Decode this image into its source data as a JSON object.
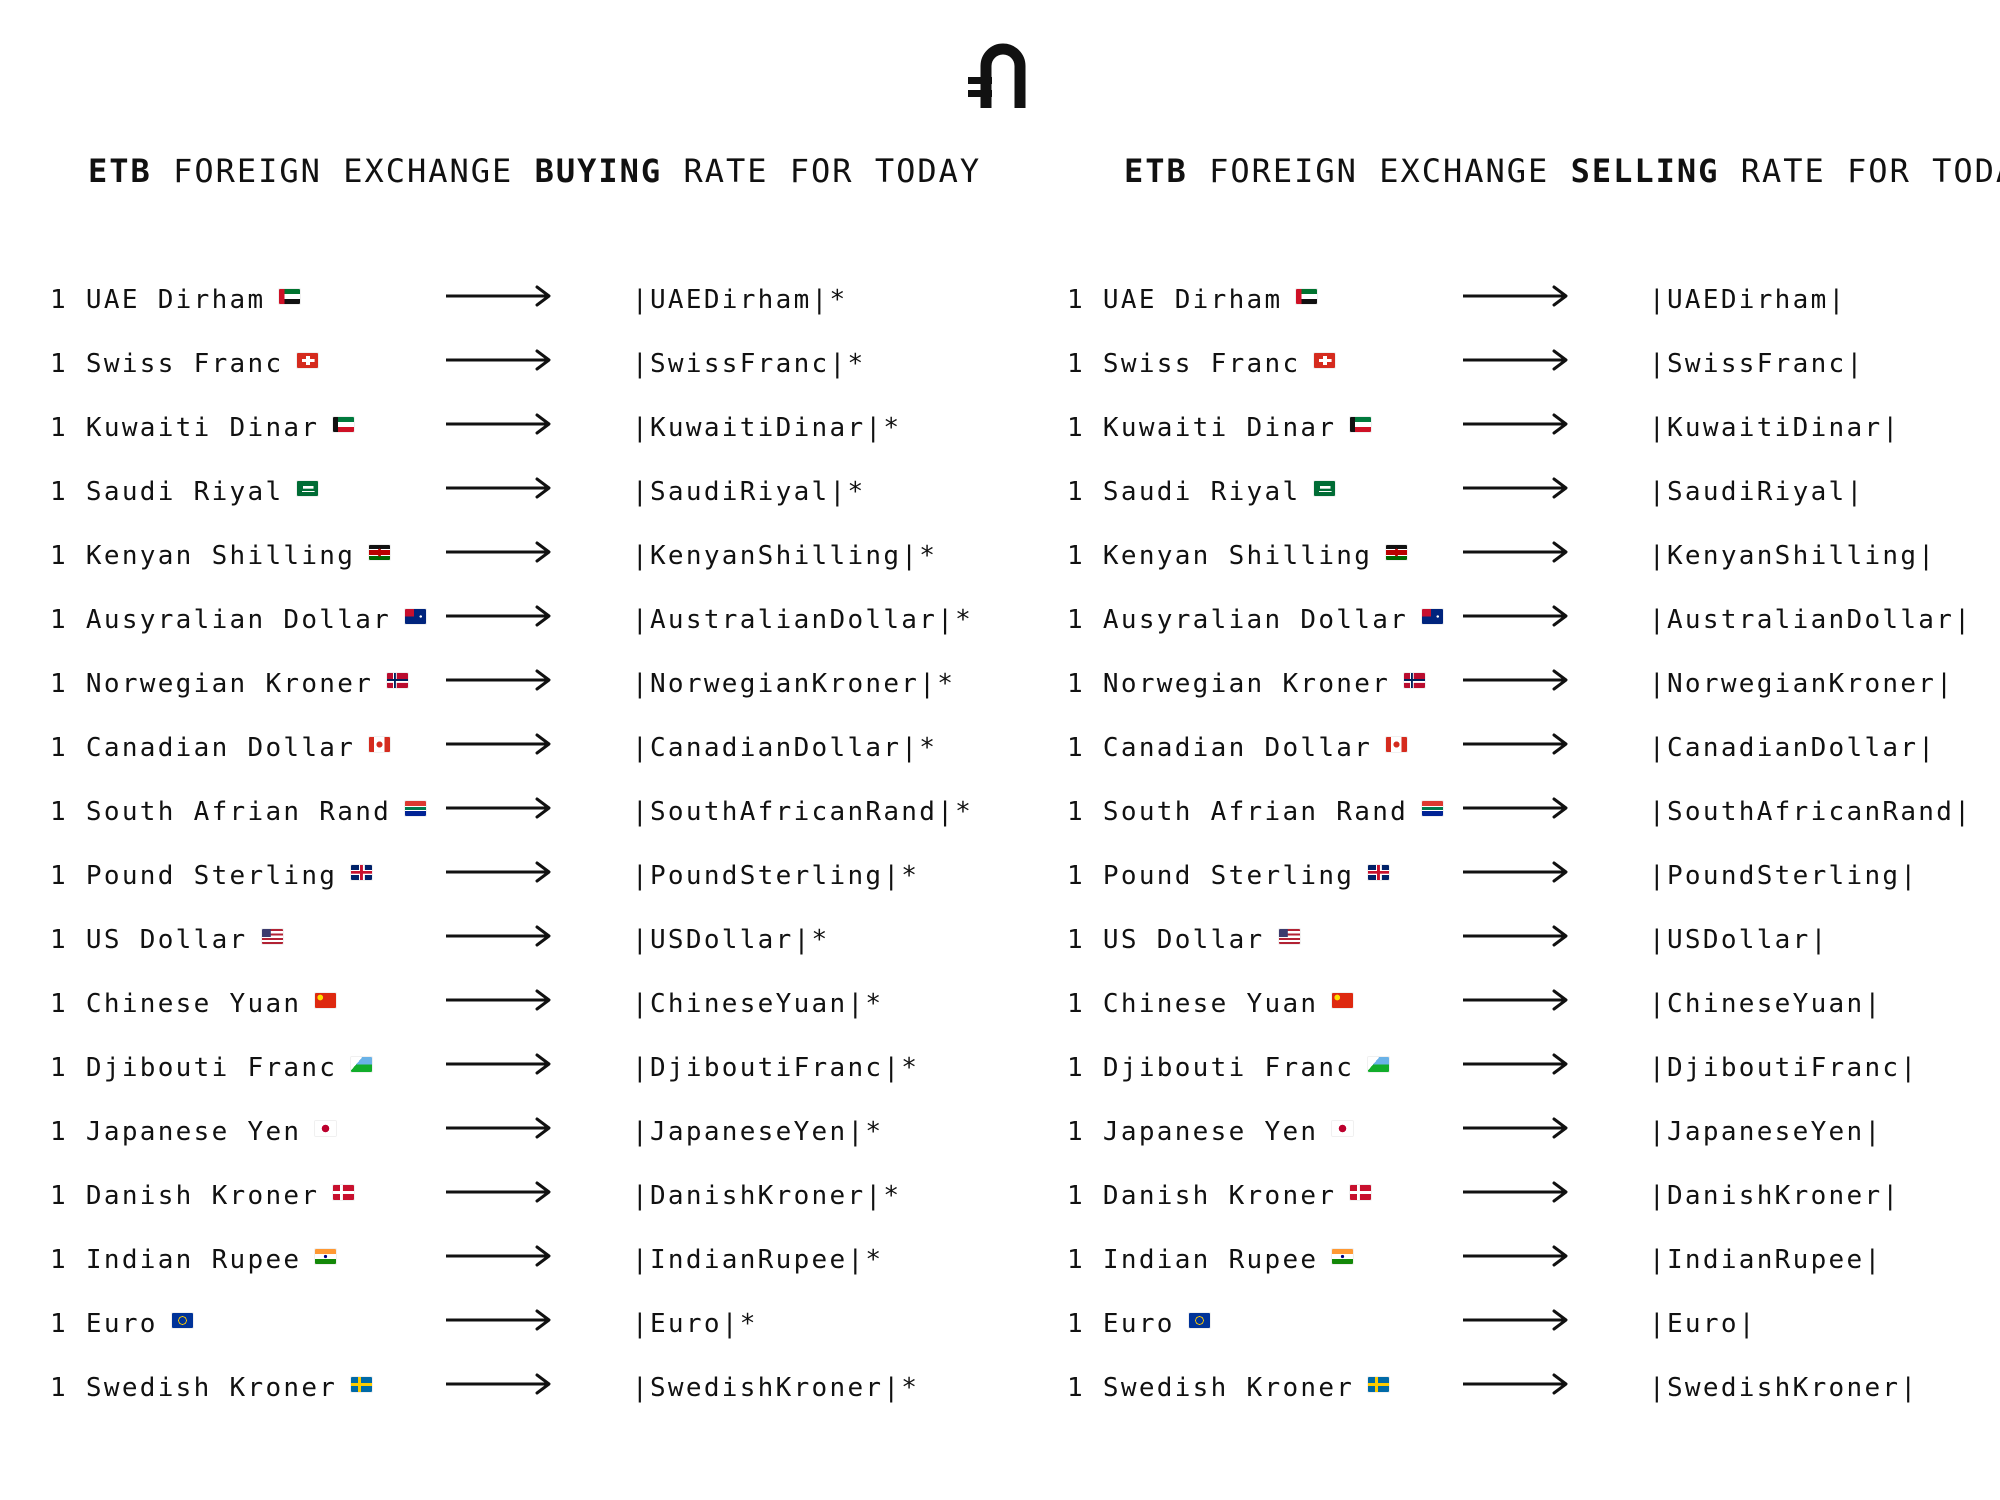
{
  "header": {
    "logo_icon": "etb-birr-logo-icon",
    "buying_title": {
      "code": "ETB",
      "pre": " FOREIGN EXCHANGE ",
      "kind": "BUYING",
      "post": " RATE FOR TODAY"
    },
    "selling_title": {
      "code": "ETB",
      "pre": " FOREIGN EXCHANGE ",
      "kind": "SELLING",
      "post": " RATE FOR TODAY"
    }
  },
  "currencies": [
    {
      "label": "1 UAE Dirham",
      "flag_icon": "uae-flag-icon",
      "buy_value": "|UAEDirham|*",
      "sell_value": "|UAEDirham|"
    },
    {
      "label": "1 Swiss Franc",
      "flag_icon": "switzerland-flag-icon",
      "buy_value": "|SwissFranc|*",
      "sell_value": "|SwissFranc|"
    },
    {
      "label": "1 Kuwaiti Dinar",
      "flag_icon": "kuwait-flag-icon",
      "buy_value": "|KuwaitiDinar|*",
      "sell_value": "|KuwaitiDinar|"
    },
    {
      "label": "1 Saudi Riyal",
      "flag_icon": "saudi-arabia-flag-icon",
      "buy_value": "|SaudiRiyal|*",
      "sell_value": "|SaudiRiyal|"
    },
    {
      "label": "1 Kenyan Shilling",
      "flag_icon": "kenya-flag-icon",
      "buy_value": "|KenyanShilling|*",
      "sell_value": "|KenyanShilling|"
    },
    {
      "label": "1 Ausyralian Dollar",
      "flag_icon": "australia-flag-icon",
      "buy_value": "|AustralianDollar|*",
      "sell_value": "|AustralianDollar|"
    },
    {
      "label": "1 Norwegian Kroner",
      "flag_icon": "norway-flag-icon",
      "buy_value": "|NorwegianKroner|*",
      "sell_value": "|NorwegianKroner|"
    },
    {
      "label": "1 Canadian Dollar",
      "flag_icon": "canada-flag-icon",
      "buy_value": "|CanadianDollar|*",
      "sell_value": "|CanadianDollar|"
    },
    {
      "label": "1 South Afrian Rand",
      "flag_icon": "south-africa-flag-icon",
      "buy_value": "|SouthAfricanRand|*",
      "sell_value": "|SouthAfricanRand|"
    },
    {
      "label": "1 Pound Sterling",
      "flag_icon": "uk-flag-icon",
      "buy_value": "|PoundSterling|*",
      "sell_value": "|PoundSterling|"
    },
    {
      "label": "1 US Dollar",
      "flag_icon": "us-flag-icon",
      "buy_value": "|USDollar|*",
      "sell_value": "|USDollar|"
    },
    {
      "label": "1 Chinese Yuan",
      "flag_icon": "china-flag-icon",
      "buy_value": "|ChineseYuan|*",
      "sell_value": "|ChineseYuan|"
    },
    {
      "label": "1 Djibouti Franc",
      "flag_icon": "djibouti-flag-icon",
      "buy_value": "|DjiboutiFranc|*",
      "sell_value": "|DjiboutiFranc|"
    },
    {
      "label": "1 Japanese Yen",
      "flag_icon": "japan-flag-icon",
      "buy_value": "|JapaneseYen|*",
      "sell_value": "|JapaneseYen|"
    },
    {
      "label": "1 Danish Kroner",
      "flag_icon": "denmark-flag-icon",
      "buy_value": "|DanishKroner|*",
      "sell_value": "|DanishKroner|"
    },
    {
      "label": "1 Indian Rupee",
      "flag_icon": "india-flag-icon",
      "buy_value": "|IndianRupee|*",
      "sell_value": "|IndianRupee|"
    },
    {
      "label": "1 Euro",
      "flag_icon": "eu-flag-icon",
      "buy_value": "|Euro|*",
      "sell_value": "|Euro|"
    },
    {
      "label": "1 Swedish Kroner",
      "flag_icon": "sweden-flag-icon",
      "buy_value": "|SwedishKroner|*",
      "sell_value": "|SwedishKroner|"
    }
  ]
}
